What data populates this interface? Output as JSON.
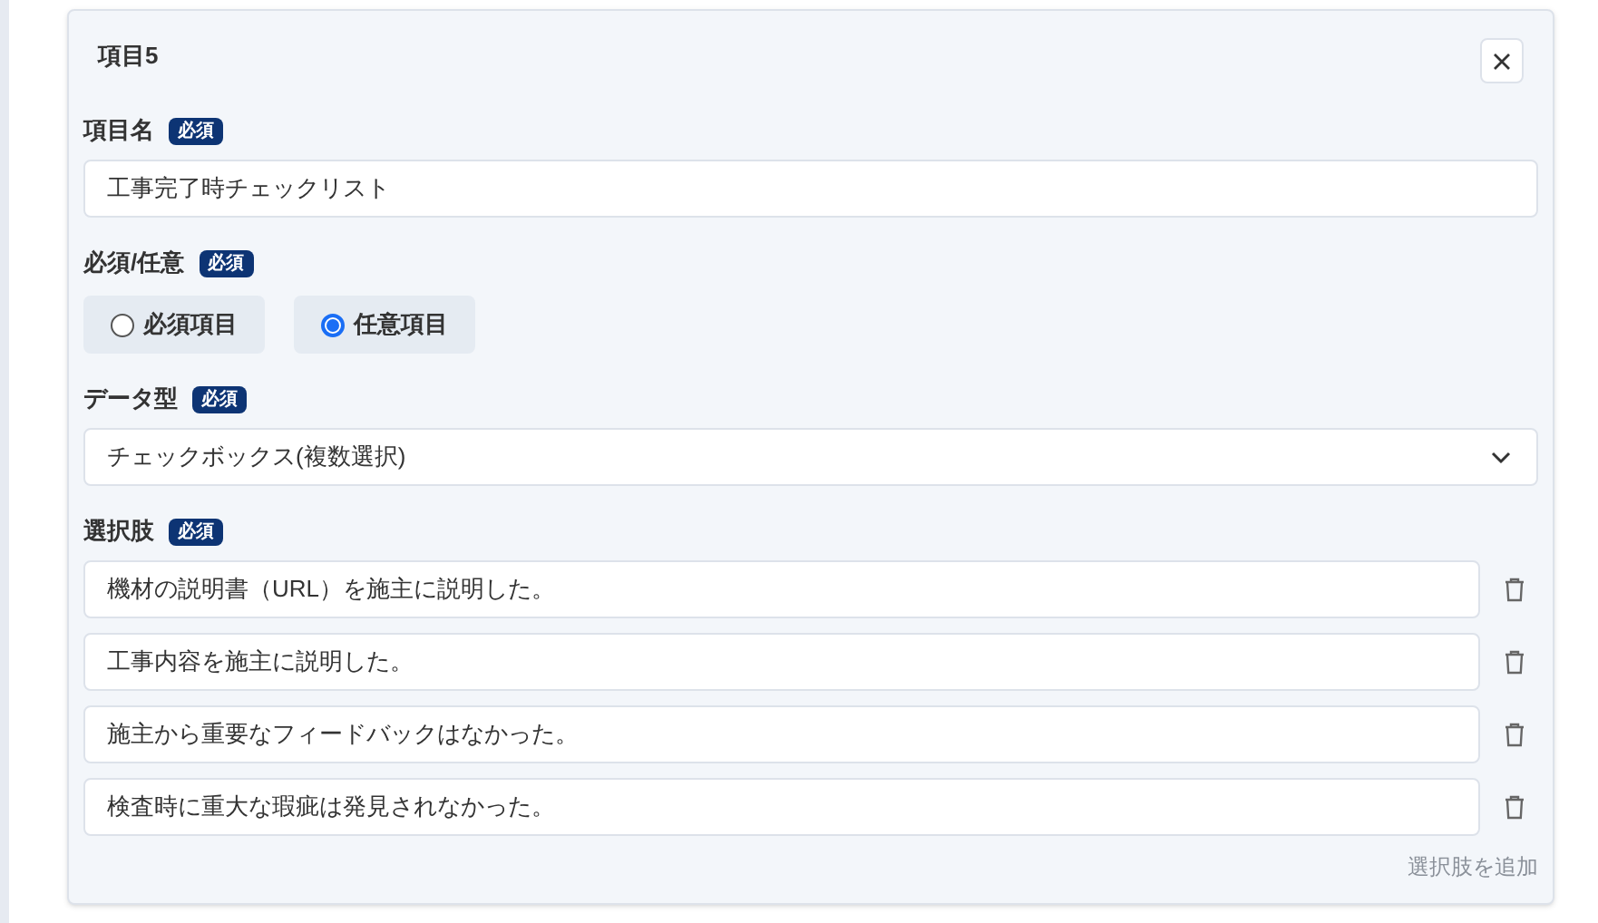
{
  "card": {
    "title": "項目5",
    "name_field": {
      "label": "項目名",
      "badge": "必須",
      "value": "工事完了時チェックリスト"
    },
    "requirement": {
      "label": "必須/任意",
      "badge": "必須",
      "options": [
        {
          "label": "必須項目",
          "selected": false
        },
        {
          "label": "任意項目",
          "selected": true
        }
      ]
    },
    "data_type": {
      "label": "データ型",
      "badge": "必須",
      "value": "チェックボックス(複数選択)"
    },
    "choices": {
      "label": "選択肢",
      "badge": "必須",
      "items": [
        "機材の説明書（URL）を施主に説明した。",
        "工事内容を施主に説明した。",
        "施主から重要なフィードバックはなかった。",
        "検査時に重大な瑕疵は発見されなかった。"
      ],
      "add_link": "選択肢を追加"
    }
  }
}
